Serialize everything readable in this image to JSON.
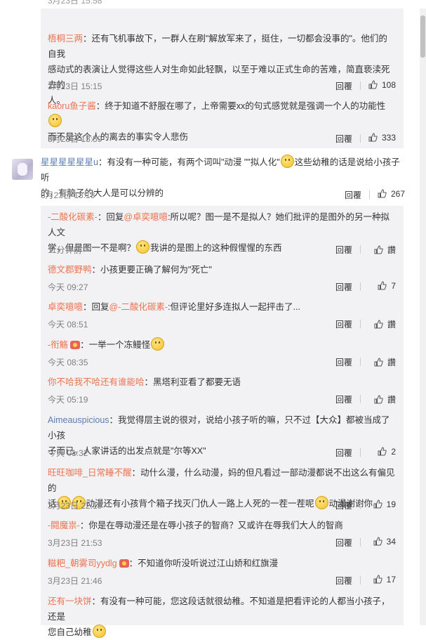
{
  "top_partial": {
    "left_text": "",
    "time": "3月23日 15:58",
    "right_labels": [
      "",
      ""
    ]
  },
  "block_a": [
    {
      "nick": "梧桐三两",
      "text_lines": [
        "：还有飞机事故下，一群人在刷\"解放军来了，挺住，一切都会没事的\"。他们的自我",
        "感动式的表演让人觉得这些人对生命如此轻飘，以至于难以正式生命的苦难，简直亵渎死去的",
        "人。"
      ],
      "time": "3月23日 15:15",
      "reply": "回覆",
      "likes": "108"
    },
    {
      "nick": "kaoru鱼子酱",
      "text_lines": [
        "：终于知道不舒服在哪了，上帝需要xx的句式感觉就是强调一个人的功能性",
        "而不是这个人的离去的事实令人悲伤"
      ],
      "time": "3月23日 13:59",
      "reply": "回覆",
      "likes": "333"
    }
  ],
  "main_comment": {
    "nick": "星星星星星星u",
    "text_lines": [
      "：有没有一种可能，有两个词叫\"动漫 \"\"拟人化\"",
      "这些幼稚的话是说给小孩子听",
      "的，有脑子的大人是可以分辨的"
    ],
    "time": "3月23日 13:13",
    "reply": "回覆",
    "likes": "267"
  },
  "block_b": [
    {
      "nick": "-二酸化碳素-",
      "reply_label": "回复",
      "at": "@卓奕噫噫",
      "text_lines": [
        ":所以呢？图一是不是拟人？她们批评的是图外的另一种拟人文",
        "学，但是图一不是啊？",
        "我讲的是图上的这种假惺惺的东西"
      ],
      "time": "11分钟前",
      "reply": "回覆",
      "likes": "讚"
    },
    {
      "nick": "德文郡野鸭",
      "text_lines": [
        "：小孩更要正确了解何为\"死亡\""
      ],
      "time": "今天 09:27",
      "reply": "回覆",
      "likes": "7"
    },
    {
      "nick": "卓奕噫噫",
      "reply_label": "回复",
      "at": "@-二酸化碳素-",
      "text_lines": [
        ":但评论里好多连拟人一起抨击了..."
      ],
      "time": "今天 08:51",
      "reply": "回覆",
      "likes": "讚"
    },
    {
      "nick": "-衔觞",
      "text_lines": [
        "：一举一个冻鳗怪"
      ],
      "time": "今天 08:35",
      "reply": "回覆",
      "likes": "讚"
    },
    {
      "nick": "你不哈我不哈还有谁能哈",
      "text_lines": [
        "：黑塔利亚看了都要无语"
      ],
      "time": "今天 05:19",
      "reply": "回覆",
      "likes": "讚"
    },
    {
      "nick": "Aimeauspicious",
      "text_lines": [
        "：我觉得层主说的很对，说给小孩子听的嘛，只不过【大众】都被当成了小孩",
        "子而已。人家讲话的出发点就是\"尔等XX\""
      ],
      "time": "今天 01:32",
      "reply": "回覆",
      "likes": "2"
    },
    {
      "nick": "旺旺咖啡_日常睡不醒",
      "text_lines": [
        "：动什么漫，什么动漫，妈的但凡看过一部动漫都说不出这么有偏见的",
        "话",
        "动漫还有小孩背个箱子找灭门仇人一路上人死的一茬一茬呢",
        "动漫谢谢你"
      ],
      "time": "3月23日 22:19",
      "reply": "回覆",
      "likes": "19"
    },
    {
      "nick": "-闘魔祟-",
      "text_lines": [
        "：你是在辱动漫还是在辱小孩子的智商？又或许在辱我们大人的智商"
      ],
      "time": "3月23日 21:53",
      "reply": "回覆",
      "likes": "34"
    },
    {
      "nick": "糍粑_朝雾司yydlg",
      "text_lines": [
        "：不知道你听没听说过江山娇和红旗漫"
      ],
      "time": "3月23日 21:46",
      "reply": "回覆",
      "likes": "17"
    },
    {
      "nick": "还有一块饼",
      "text_lines": [
        "：有没有一种可能，您这段话就很幼稚。不知道是把看评论的人都当小孩子，还是",
        "您自己幼稚"
      ],
      "time": "",
      "reply": "",
      "likes": ""
    }
  ],
  "colors": {
    "nick": "#eb7350",
    "nick_blue": "#5a7db3",
    "reply_bg": "#f2f2f5",
    "text": "#333333",
    "meta": "#808080"
  },
  "icons": {
    "like": "thumbs-up-icon",
    "emoji": "smiley-emoji-icon",
    "badge": "level-badge-icon"
  }
}
